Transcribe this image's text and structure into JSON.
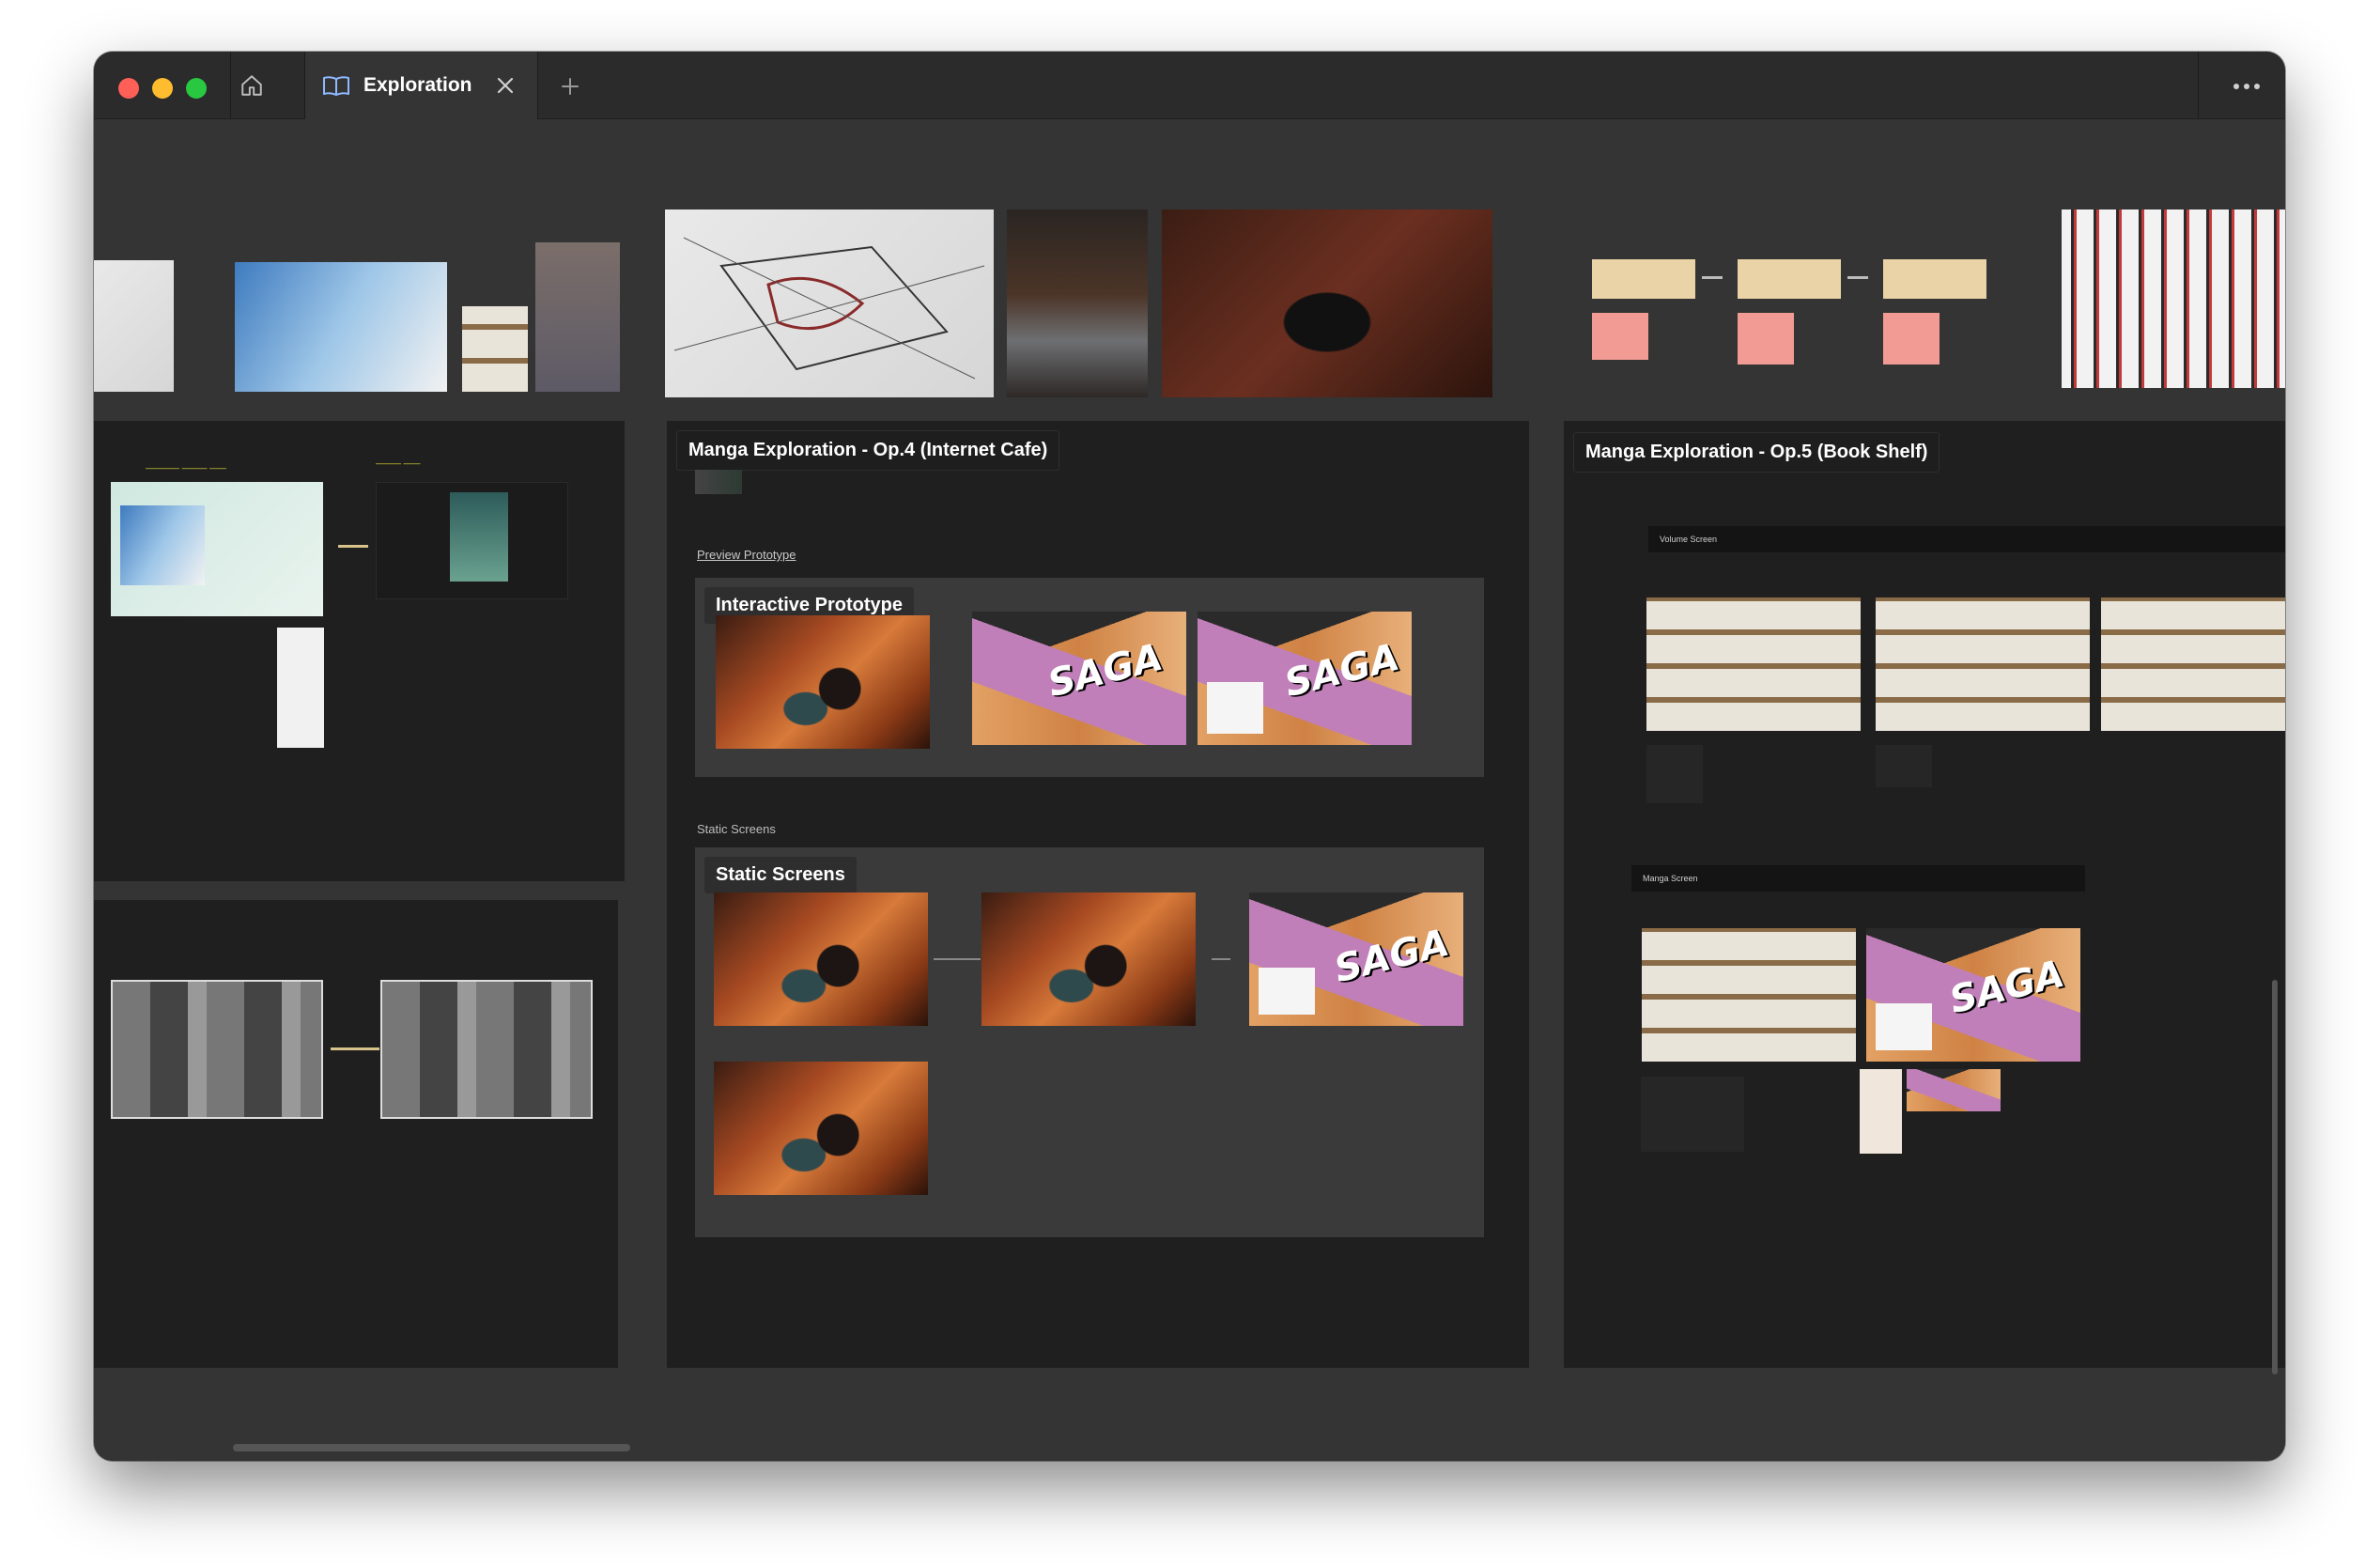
{
  "window": {
    "tab_label": "Exploration",
    "tab_icon": "book-open-icon"
  },
  "frames": {
    "op4_title": "Manga Exploration - Op.4 (Internet Cafe)",
    "op5_title": "Manga Exploration - Op.5 (Book Shelf)",
    "preview_link": "Preview Prototype",
    "interactive_title": "Interactive Prototype",
    "static_link": "Static Screens",
    "static_title": "Static Screens",
    "saga_word": "SAGA",
    "op5_bar1": "Volume Screen",
    "op5_bar2": "Manga Screen"
  },
  "colors": {
    "canvas": "#343434",
    "frame": "#1f1f1f",
    "section": "#3a3a3a",
    "sticky": "#f29b94"
  }
}
